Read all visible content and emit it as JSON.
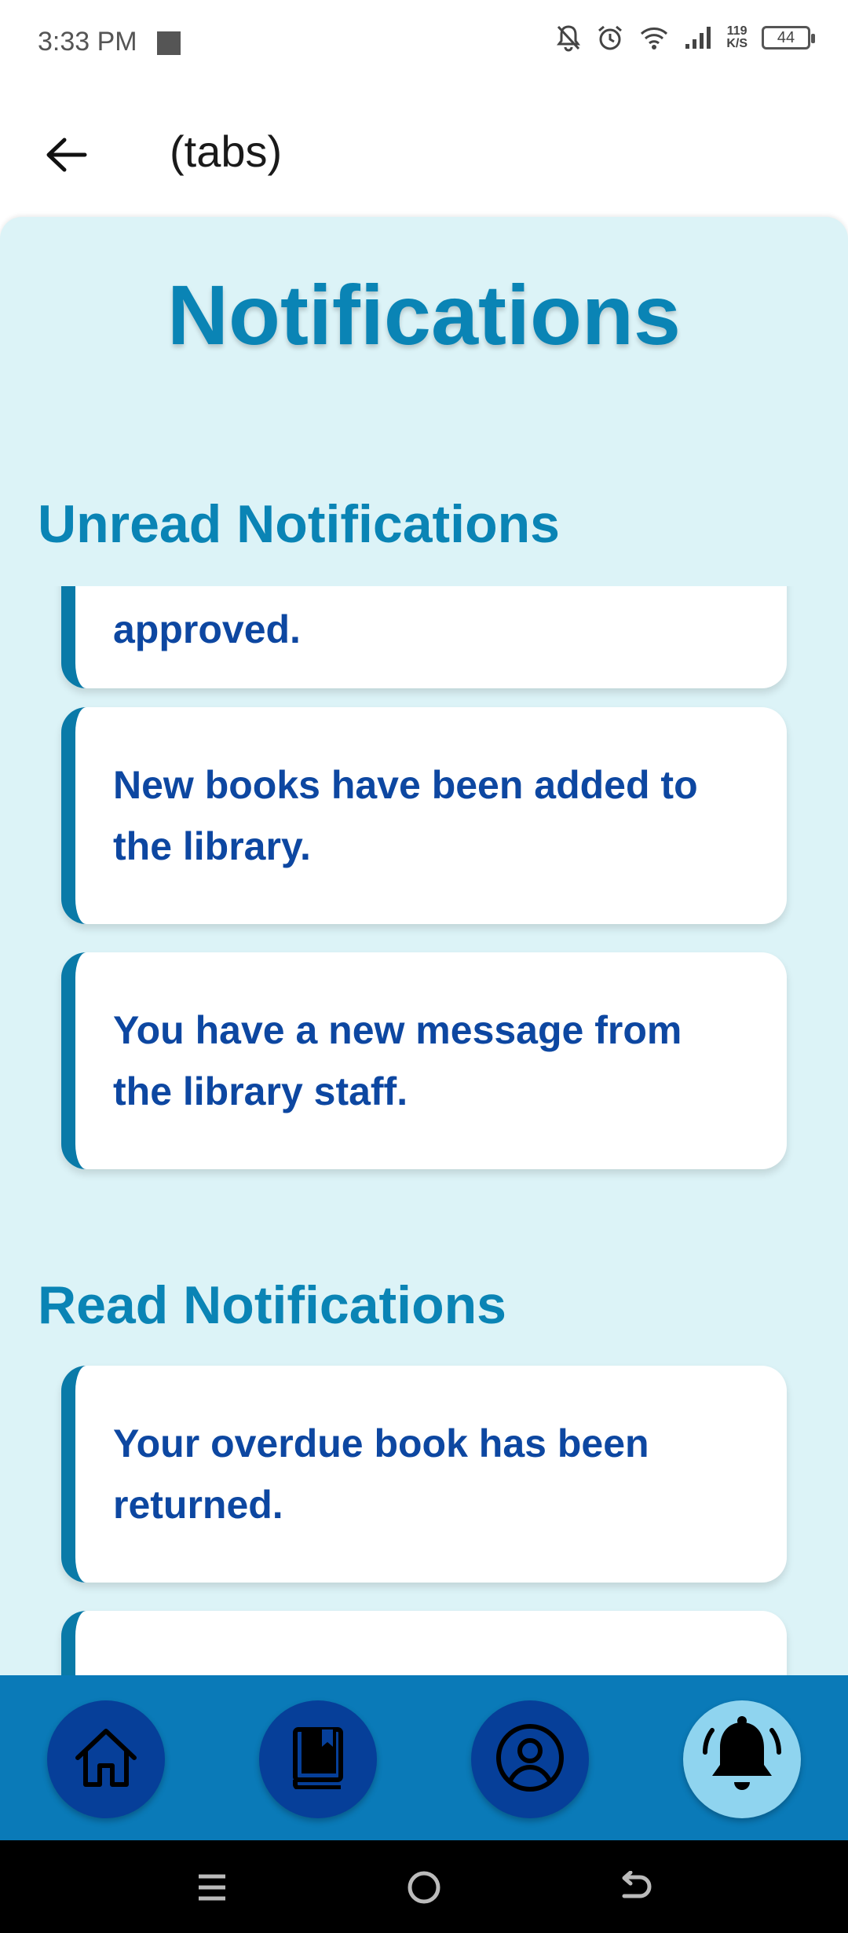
{
  "status_bar": {
    "time": "3:33 PM",
    "net_speed_top": "119",
    "net_speed_bottom": "K/S",
    "battery": "44",
    "icons": [
      "stop-icon",
      "mute-bell-icon",
      "alarm-icon",
      "wifi-icon",
      "signal-icon",
      "battery-icon"
    ]
  },
  "header": {
    "title": "(tabs)",
    "back_icon": "back-arrow-icon"
  },
  "page": {
    "title": "Notifications"
  },
  "unread": {
    "title": "Unread Notifications",
    "items": [
      {
        "text": "approved."
      },
      {
        "text": "New books have been added to the library."
      },
      {
        "text": "You have a new message from the library staff."
      }
    ]
  },
  "read": {
    "title": "Read Notifications",
    "items": [
      {
        "text": "Your overdue book has been returned."
      },
      {
        "text": ""
      }
    ]
  },
  "bottom_nav": {
    "items": [
      {
        "icon": "home-icon",
        "active": false
      },
      {
        "icon": "book-icon",
        "active": false
      },
      {
        "icon": "profile-icon",
        "active": false
      },
      {
        "icon": "bell-icon",
        "active": true
      }
    ]
  },
  "system_nav": {
    "icons": [
      "menu-icon",
      "home-circle-icon",
      "back-icon"
    ]
  },
  "colors": {
    "accent": "#0a84b5",
    "text_dark_blue": "#0d47a1",
    "content_bg": "#dcf3f7",
    "nav_bg": "#0a7ab8",
    "nav_button": "#063f99",
    "nav_button_active": "#8fd4ef"
  }
}
